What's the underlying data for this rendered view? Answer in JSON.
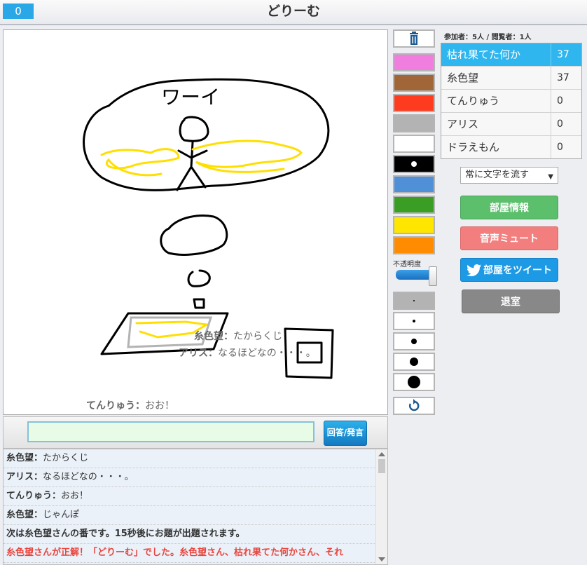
{
  "header": {
    "counter": "0",
    "title": "どりーむ"
  },
  "canvas": {
    "overlay_messages": [
      {
        "name": "糸色望",
        "sep": "：",
        "text": "たからくじ"
      },
      {
        "name": "アリス",
        "sep": "：",
        "text": "なるほどなの・・・。"
      },
      {
        "name": "てんりゅう",
        "sep": "：",
        "text": "おお！"
      }
    ],
    "drawing_text": "ワーイ"
  },
  "input": {
    "value": "",
    "send_label": "回答/発言"
  },
  "chat": [
    {
      "name": "糸色望",
      "sep": "：",
      "text": "たからくじ"
    },
    {
      "name": "アリス",
      "sep": "：",
      "text": "なるほどなの・・・。"
    },
    {
      "name": "てんりゅう",
      "sep": "：",
      "text": "おお！"
    },
    {
      "name": "糸色望",
      "sep": "：",
      "text": "じゃんぽ"
    },
    {
      "system": "次は糸色望さんの番です。15秒後にお題が出題されます。"
    },
    {
      "correct": "糸色望さんが正解！「どりーむ」でした。糸色望さん、枯れ果てた何かさん、それ"
    }
  ],
  "tools": {
    "colors": [
      "#f07ede",
      "#a16637",
      "#ff3b1f",
      "#b3b3b3",
      "#ffffff",
      "#000000",
      "#4f90d6",
      "#3a9d24",
      "#ffe600",
      "#ff8c00"
    ],
    "selected_color": "#000000",
    "opacity_label": "不透明度",
    "opacity": 1.0,
    "icons": [
      "trash-icon",
      "undo-icon"
    ]
  },
  "info": {
    "participants_label": "参加者：",
    "participants": "5人",
    "viewers_label": "閲覧者：",
    "viewers": "1人"
  },
  "scoreboard": [
    {
      "name": "枯れ果てた何か",
      "score": "37",
      "active": true
    },
    {
      "name": "糸色望",
      "score": "37",
      "active": false
    },
    {
      "name": "てんりゅう",
      "score": "0",
      "active": false
    },
    {
      "name": "アリス",
      "score": "0",
      "active": false
    },
    {
      "name": "ドラえもん",
      "score": "0",
      "active": false
    }
  ],
  "controls": {
    "scroll_mode": "常に文字を流す",
    "room_info": "部屋情報",
    "mute": "音声ミュート",
    "tweet": "部屋をツイート",
    "leave": "退室"
  },
  "colors": {
    "accent": "#2fb6ee",
    "green": "#5bbf6c",
    "red": "#f27e7e",
    "twitter": "#1d9ae6",
    "gray": "#888888"
  }
}
